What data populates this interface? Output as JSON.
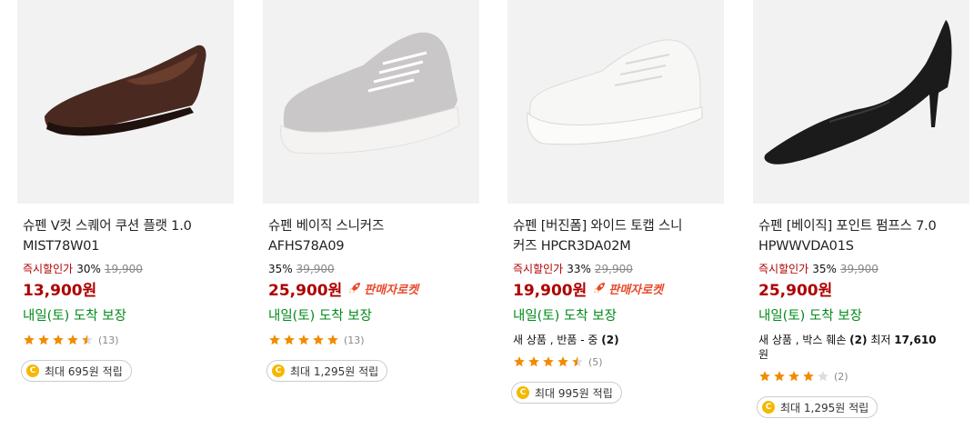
{
  "products": [
    {
      "name_line1": "슈펜 V컷 스퀘어 쿠션 플랫 1.0",
      "name_line2": "MIST78W01",
      "instant_label": "즉시할인가",
      "discount": "30%",
      "original_price": "19,900",
      "price": "13,900원",
      "rocket_label": "",
      "delivery": "내일(토) 도착 보장",
      "extra_text": "",
      "rating": 4.5,
      "review_count": "(13)",
      "cashback": "최대 695원 적립",
      "image_icon": "brown-flat-shoe"
    },
    {
      "name_line1": "슈펜 베이직 스니커즈",
      "name_line2": "AFHS78A09",
      "instant_label": "",
      "discount": "35%",
      "original_price": "39,900",
      "price": "25,900원",
      "rocket_label": "판매자로켓",
      "delivery": "내일(토) 도착 보장",
      "extra_text": "",
      "rating": 5,
      "review_count": "(13)",
      "cashback": "최대 1,295원 적립",
      "image_icon": "grey-sneaker"
    },
    {
      "name_line1": "슈펜 [버진폼] 와이드 토캡 스니",
      "name_line2": "커즈 HPCR3DA02M",
      "instant_label": "즉시할인가",
      "discount": "33%",
      "original_price": "29,900",
      "price": "19,900원",
      "rocket_label": "판매자로켓",
      "delivery": "내일(토) 도착 보장",
      "extra_text": "새 상품 , 반품 - 중 (2)",
      "rating": 4.5,
      "review_count": "(5)",
      "cashback": "최대 995원 적립",
      "image_icon": "white-sneaker"
    },
    {
      "name_line1": "슈펜 [베이직] 포인트 펌프스 7.0",
      "name_line2": "HPWWVDA01S",
      "instant_label": "즉시할인가",
      "discount": "35%",
      "original_price": "39,900",
      "price": "25,900원",
      "rocket_label": "",
      "delivery": "내일(토) 도착 보장",
      "extra_text": "새 상품 , 박스 훼손 (2) 최저 17,610",
      "extra_text2": "원",
      "rating": 4,
      "review_count": "(2)",
      "cashback": "최대 1,295원 적립",
      "image_icon": "black-pump-heel"
    }
  ],
  "colors": {
    "price_red": "#ae0000",
    "delivery_green": "#00891a",
    "rocket_orange": "#e8492a",
    "star_orange": "#f28b00",
    "coin_gold": "#f5b800"
  },
  "icons": {
    "rocket": "rocket-icon",
    "star": "star-icon",
    "coin": "coin-icon",
    "coin_glyph": "C"
  }
}
